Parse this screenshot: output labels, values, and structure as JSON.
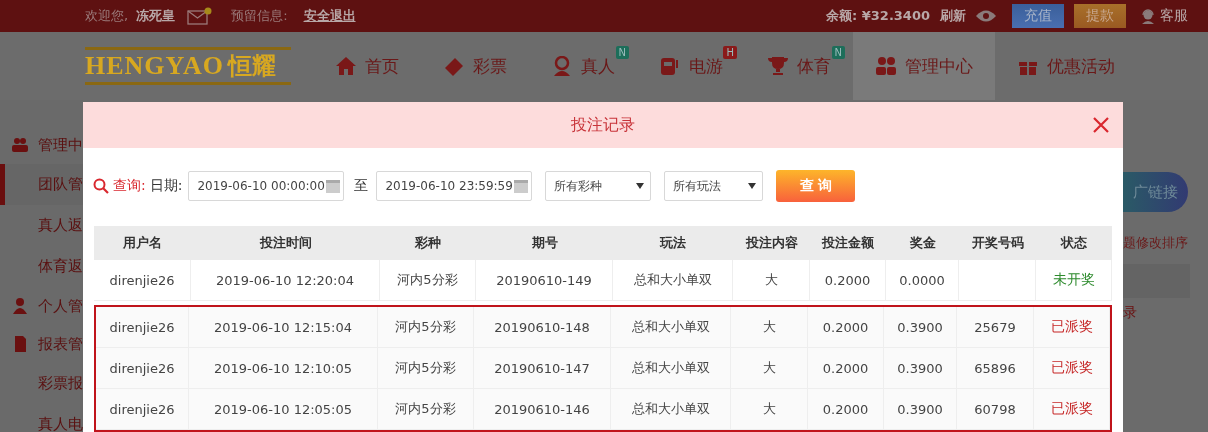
{
  "top_bar": {
    "welcome": "欢迎您,",
    "username": "冻死皇",
    "message_label": "预留信息:",
    "logout": "安全退出",
    "balance": "余额: ¥32.3400",
    "refresh": "刷新",
    "deposit": "充值",
    "withdraw": "提款",
    "support": "客服"
  },
  "logo": {
    "latin": "HENGYAO",
    "chinese": "恒耀"
  },
  "nav": [
    {
      "label": "首页",
      "kind": "home",
      "selected": false
    },
    {
      "label": "彩票",
      "kind": "lottery",
      "selected": false
    },
    {
      "label": "真人",
      "kind": "live",
      "badge": {
        "text": "N",
        "color": "#1d6e5a"
      },
      "selected": false
    },
    {
      "label": "电游",
      "kind": "slots",
      "badge": {
        "text": "H",
        "color": "#8a1a1a"
      },
      "selected": false
    },
    {
      "label": "体育",
      "kind": "sports",
      "badge": {
        "text": "N",
        "color": "#1d6e5a"
      },
      "selected": false
    },
    {
      "label": "管理中心",
      "kind": "manage",
      "selected": true
    },
    {
      "label": "优惠活动",
      "kind": "promo",
      "selected": false
    }
  ],
  "sidebar": [
    {
      "label": "管理中",
      "kind": "team",
      "selected": false
    },
    {
      "label": "团队管",
      "kind": "item",
      "selected": true
    },
    {
      "label": "真人返",
      "kind": "item",
      "selected": false
    },
    {
      "label": "体育返",
      "kind": "item",
      "selected": false
    },
    {
      "label": "个人管",
      "kind": "personal",
      "selected": false
    },
    {
      "label": "报表管",
      "kind": "report",
      "selected": false
    },
    {
      "label": "彩票报",
      "kind": "item",
      "selected": false
    },
    {
      "label": "真人电",
      "kind": "item",
      "selected": false
    }
  ],
  "right_panel": {
    "button": "广链接",
    "note": "题修改排序",
    "link": "录"
  },
  "modal": {
    "title": "投注记录",
    "query_label": "查询:",
    "date_label": "日期:",
    "date_from": "2019-06-10 00:00:00",
    "to_label": "至",
    "date_to": "2019-06-10 23:59:59",
    "lottery_select": "所有彩种",
    "play_select": "所有玩法",
    "search_button": "查 询"
  },
  "table": {
    "columns": [
      "用户名",
      "投注时间",
      "彩种",
      "期号",
      "玩法",
      "投注内容",
      "投注金额",
      "奖金",
      "开奖号码",
      "状态"
    ],
    "rows": [
      {
        "user": "direnjie26",
        "time": "2019-06-10 12:20:04",
        "lottery": "河内5分彩",
        "issue": "20190610-149",
        "play": "总和大小单双",
        "content": "大",
        "amount": "0.2000",
        "prize": "0.0000",
        "status": "未开奖",
        "color": "#2e8b2e",
        "highlighted": false
      },
      {
        "user": "direnjie26",
        "time": "2019-06-10 12:15:04",
        "lottery": "河内5分彩",
        "issue": "20190610-148",
        "play": "总和大小单双",
        "content": "大",
        "amount": "0.2000",
        "prize": "0.3900",
        "numbers": "25679",
        "status": "已派奖",
        "color": "#c62828",
        "highlighted": true
      },
      {
        "user": "direnjie26",
        "time": "2019-06-10 12:10:05",
        "lottery": "河内5分彩",
        "issue": "20190610-147",
        "play": "总和大小单双",
        "content": "大",
        "amount": "0.2000",
        "prize": "0.3900",
        "numbers": "65896",
        "status": "已派奖",
        "color": "#c62828",
        "highlighted": true
      },
      {
        "user": "direnjie26",
        "time": "2019-06-10 12:05:05",
        "lottery": "河内5分彩",
        "issue": "20190610-146",
        "play": "总和大小单双",
        "content": "大",
        "amount": "0.2000",
        "prize": "0.3900",
        "numbers": "60798",
        "status": "已派奖",
        "color": "#c62828",
        "highlighted": true
      }
    ]
  }
}
